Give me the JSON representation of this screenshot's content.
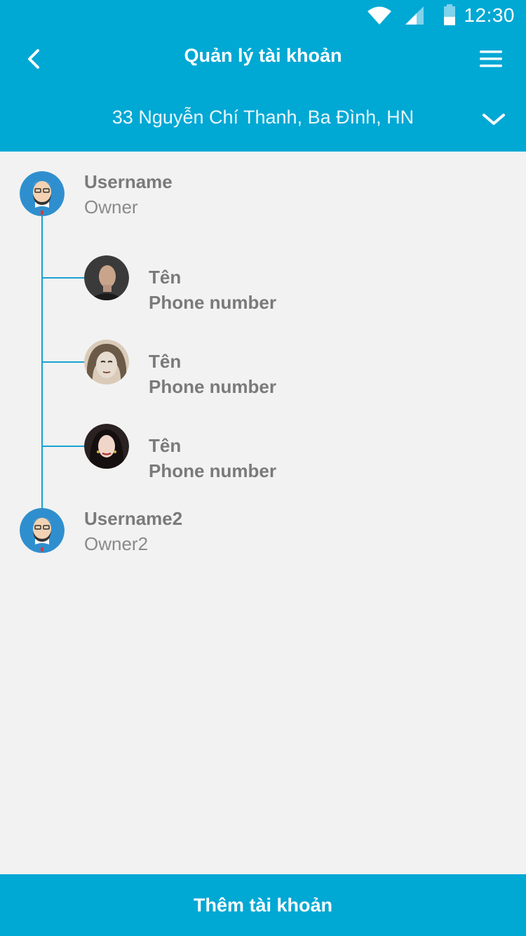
{
  "status_bar": {
    "time": "12:30",
    "icons": [
      "wifi-icon",
      "signal-icon",
      "battery-icon"
    ]
  },
  "header": {
    "title": "Quản lý tài khoản",
    "address": "33 Nguyễn Chí Thanh, Ba Đình, HN",
    "icons": {
      "back": "chevron-left-icon",
      "menu": "hamburger-menu-icon",
      "address_toggle": "chevron-down-icon"
    }
  },
  "tree": {
    "owners": [
      {
        "name": "Username",
        "role": "Owner"
      },
      {
        "name": "Username2",
        "role": "Owner2"
      }
    ],
    "members": [
      {
        "name": "Tên",
        "phone": "Phone number"
      },
      {
        "name": "Tên",
        "phone": "Phone number"
      },
      {
        "name": "Tên",
        "phone": "Phone number"
      }
    ]
  },
  "footer": {
    "add_button": "Thêm tài khoản"
  },
  "colors": {
    "primary": "#00a8d4",
    "background": "#f2f2f2",
    "tree_line": "#1aa2d0",
    "text_gray": "#7a7a7a"
  }
}
